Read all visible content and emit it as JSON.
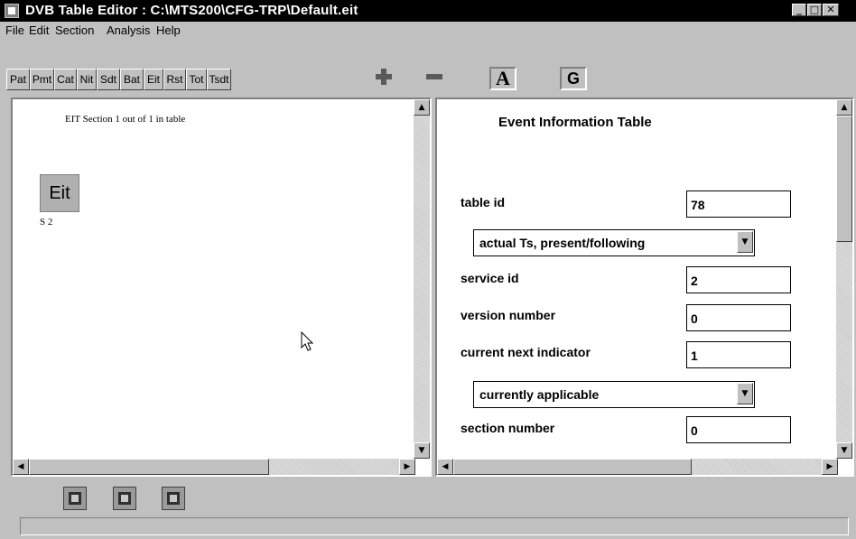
{
  "window": {
    "title": "DVB Table Editor : C:\\MTS200\\CFG-TRP\\Default.eit",
    "minimize": "_",
    "maximize": "□",
    "close": "✕"
  },
  "menu": [
    "File",
    "Edit",
    "Section",
    "Analysis",
    "Help"
  ],
  "table_tabs": [
    "Pat",
    "Pmt",
    "Cat",
    "Nit",
    "Sdt",
    "Bat",
    "Eit",
    "Rst",
    "Tot",
    "Tsdt"
  ],
  "toolbar_icons": {
    "add": "plus-icon",
    "remove": "minus-icon",
    "a_label": "A",
    "g_label": "G"
  },
  "left_panel": {
    "heading": "EIT Section 1 out of 1 in table",
    "node_label": "Eit",
    "node_caption": "S 2"
  },
  "right_panel": {
    "heading": "Event Information Table",
    "fields": {
      "table_id": {
        "label": "table id",
        "value": "78"
      },
      "table_id_desc": "actual Ts, present/following",
      "service_id": {
        "label": "service id",
        "value": "2"
      },
      "version_number": {
        "label": "version number",
        "value": "0"
      },
      "current_next_indicator": {
        "label": "current next indicator",
        "value": "1"
      },
      "cni_desc": "currently applicable",
      "section_number": {
        "label": "section number",
        "value": "0"
      }
    }
  },
  "scroll_glyphs": {
    "up": "▲",
    "down": "▼",
    "left": "◀",
    "right": "▶"
  },
  "colors": {
    "titlebar": "#000000",
    "face": "#c0c0c0",
    "node": "#b0b0b0",
    "plus": "#5a5a5a"
  }
}
